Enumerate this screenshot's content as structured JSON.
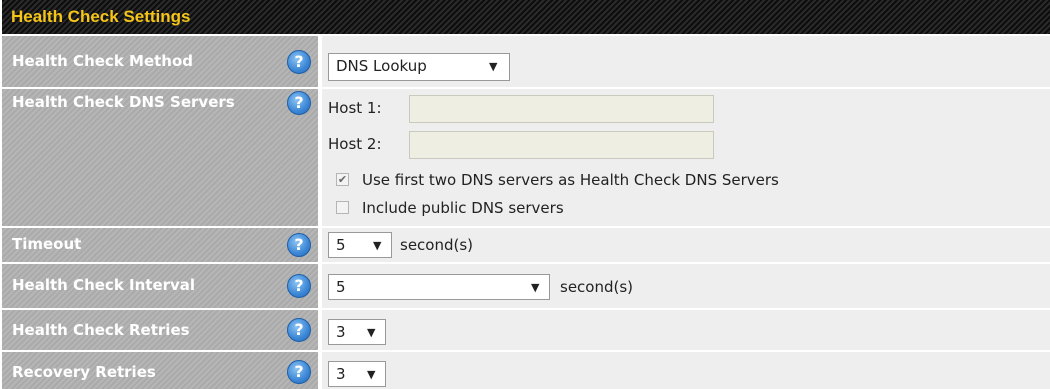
{
  "header": {
    "title": "Health Check Settings"
  },
  "help_glyph": "?",
  "rows": {
    "method": {
      "label": "Health Check Method",
      "value": "DNS Lookup"
    },
    "dns_servers": {
      "label": "Health Check DNS Servers",
      "host1_label": "Host 1:",
      "host1_value": "",
      "host2_label": "Host 2:",
      "host2_value": "",
      "use_first_two_label": "Use first two DNS servers as Health Check DNS Servers",
      "use_first_two_checked": true,
      "include_public_label": "Include public DNS servers",
      "include_public_checked": false
    },
    "timeout": {
      "label": "Timeout",
      "value": "5",
      "unit": "second(s)"
    },
    "interval": {
      "label": "Health Check Interval",
      "value": "5",
      "unit": "second(s)"
    },
    "retries": {
      "label": "Health Check Retries",
      "value": "3"
    },
    "recovery": {
      "label": "Recovery Retries",
      "value": "3"
    }
  },
  "glyphs": {
    "dropdown_arrow": "▼",
    "check_mark": "✔"
  },
  "colors": {
    "header_text": "#f5c518",
    "label_bg": "#b0b0b0",
    "value_bg": "#eeeeee",
    "help_icon": "#3b86d6"
  }
}
